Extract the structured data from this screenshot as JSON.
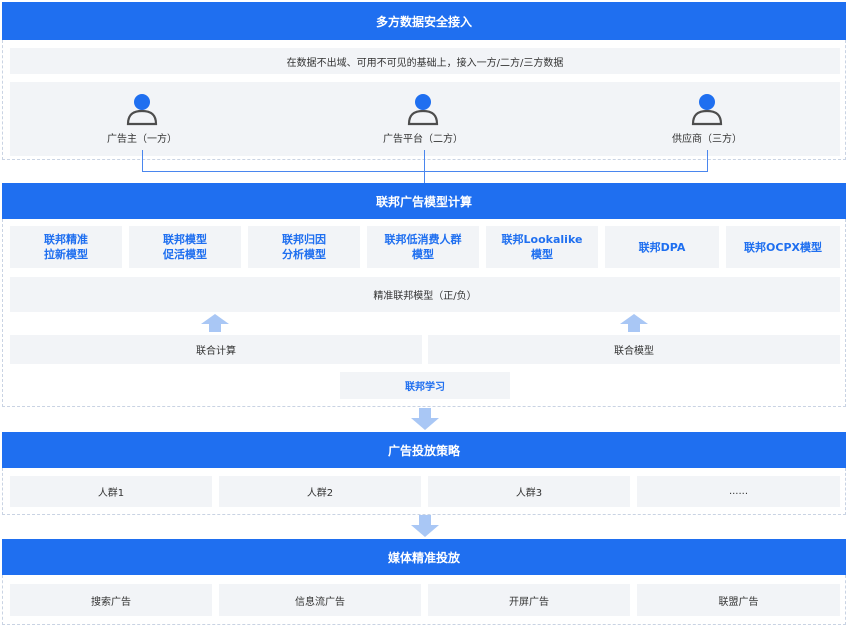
{
  "sections": {
    "access": {
      "title": "多方数据安全接入",
      "subtitle": "在数据不出域、可用不可见的基础上，接入一方/二方/三方数据",
      "parties": [
        "广告主（一方）",
        "广告平台（二方）",
        "供应商（三方）"
      ]
    },
    "federated": {
      "title": "联邦广告模型计算",
      "models": [
        [
          "联邦精准",
          "拉新模型"
        ],
        [
          "联邦模型",
          "促活模型"
        ],
        [
          "联邦归因",
          "分析模型"
        ],
        [
          "联邦低消费人群",
          "模型"
        ],
        [
          "联邦Lookalike",
          "模型"
        ],
        [
          "联邦DPA"
        ],
        [
          "联邦OCPX模型"
        ]
      ],
      "precision_model": "精准联邦模型（正/负）",
      "joint_compute": "联合计算",
      "joint_model": "联合模型",
      "federated_learning": "联邦学习"
    },
    "strategy": {
      "title": "广告投放策略",
      "groups": [
        "人群1",
        "人群2",
        "人群3",
        "......"
      ]
    },
    "media": {
      "title": "媒体精准投放",
      "channels": [
        "搜索广告",
        "信息流广告",
        "开屏广告",
        "联盟广告"
      ]
    }
  },
  "colors": {
    "accent": "#1f6ff0",
    "box_bg": "#f2f4f7",
    "arrow": "#a9c7f5"
  },
  "icons": {
    "party": "user-icon",
    "flow": "up-arrow-icon",
    "down": "down-arrow-icon"
  }
}
